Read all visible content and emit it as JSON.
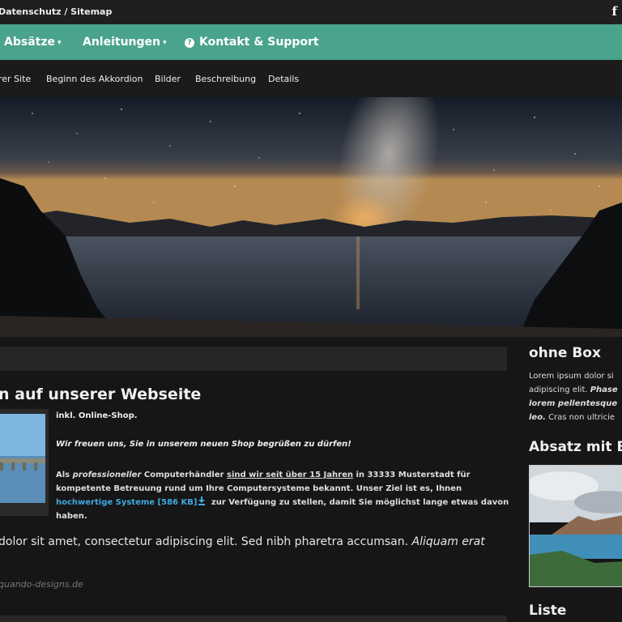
{
  "topbar": {
    "links": "Datenschutz / Sitemap",
    "facebook_label": "f"
  },
  "nav": {
    "items": [
      {
        "label": "Absätze",
        "chevron": "▾"
      },
      {
        "label": "Anleitungen",
        "chevron": "▾"
      },
      {
        "label": "Kontakt & Support",
        "icon": "?"
      }
    ]
  },
  "subnav": {
    "items": [
      "rer Site",
      "Beginn des Akkordion",
      "Bilder",
      "Beschreibung",
      "Details"
    ]
  },
  "hero": {
    "alt": "starry-sky-lake"
  },
  "main": {
    "heading": "n auf unserer Webseite",
    "p1": "inkl. Online-Shop.",
    "p2": "Wir freuen uns, Sie in unserem neuen Shop begrüßen zu dürfen!",
    "p3": {
      "a": "Als ",
      "b": "professioneller",
      "c": " Computerhändler ",
      "d": "sind wir seit über 15 Jahren",
      "e": " in 33333 Musterstadt für kompetente Betreuung rund um Ihre Computersysteme bekannt. Unser Ziel ist es, Ihnen ",
      "link": "hochwertige Systeme [586 KB]",
      "f": " zur Verfügung zu stellen, damit Sie möglichst lange etwas davon haben."
    },
    "lorem_regular": "dolor sit amet, consectetur adipiscing elit. Sed nibh pharetra accumsan. ",
    "lorem_italic": "Aliquam erat",
    "source": "quando-designs.de"
  },
  "sidebar": {
    "h1": "ohne Box",
    "text_a": "Lorem ipsum dolor si",
    "text_b": "adipiscing elit. ",
    "text_c": "Phase",
    "text_d": "lorem pellentesque",
    "text_e": "leo.",
    "text_f": " Cras non ultricie",
    "h2": "Absatz mit B",
    "h3": "Liste"
  },
  "colors": {
    "nav_green": "#4aa38c",
    "link_blue": "#3fa9e0",
    "background": "#151515"
  }
}
